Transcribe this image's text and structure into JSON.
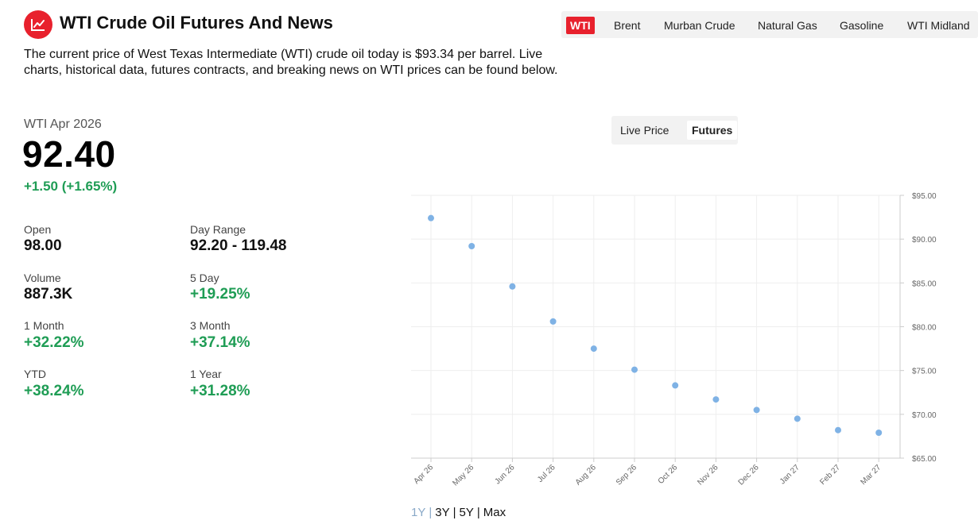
{
  "header": {
    "title": "WTI Crude Oil Futures And News",
    "logo_icon": "chart-line-icon",
    "accent_color": "#e8212d"
  },
  "commodity_tabs": [
    {
      "label": "WTI",
      "active": true
    },
    {
      "label": "Brent",
      "active": false
    },
    {
      "label": "Murban Crude",
      "active": false
    },
    {
      "label": "Natural Gas",
      "active": false
    },
    {
      "label": "Gasoline",
      "active": false
    },
    {
      "label": "WTI Midland",
      "active": false
    }
  ],
  "intro_text": "The current price of West Texas Intermediate (WTI) crude oil today is $93.34 per barrel. Live charts, historical data, futures contracts, and breaking news on WTI prices can be found below.",
  "quote": {
    "contract": "WTI Apr 2026",
    "price": "92.40",
    "change": "+1.50 (+1.65%)",
    "positive_color": "#1f9d55"
  },
  "stats": {
    "open_label": "Open",
    "open_value": "98.00",
    "day_range_label": "Day Range",
    "day_range_value": "92.20 - 119.48",
    "volume_label": "Volume",
    "volume_value": "887.3K",
    "five_day_label": "5 Day",
    "five_day_value": "+19.25%",
    "one_month_label": "1 Month",
    "one_month_value": "+32.22%",
    "three_month_label": "3 Month",
    "three_month_value": "+37.14%",
    "ytd_label": "YTD",
    "ytd_value": "+38.24%",
    "one_year_label": "1 Year",
    "one_year_value": "+31.28%"
  },
  "view_toggle": {
    "live_price": "Live Price",
    "futures": "Futures",
    "active": "Futures"
  },
  "chart_data": {
    "type": "scatter",
    "title": "",
    "xlabel": "",
    "ylabel": "",
    "categories": [
      "Apr 26",
      "May 26",
      "Jun 26",
      "Jul 26",
      "Aug 26",
      "Sep 26",
      "Oct 26",
      "Nov 26",
      "Dec 26",
      "Jan 27",
      "Feb 27",
      "Mar 27"
    ],
    "values": [
      92.4,
      89.2,
      84.6,
      80.6,
      77.5,
      75.1,
      73.3,
      71.7,
      70.5,
      69.5,
      68.2,
      67.9
    ],
    "ylim": [
      65,
      95
    ],
    "yticks": [
      "$95.00",
      "$90.00",
      "$85.00",
      "$80.00",
      "$75.00",
      "$70.00",
      "$65.00"
    ],
    "ytick_values": [
      95,
      90,
      85,
      80,
      75,
      70,
      65
    ],
    "y_axis_position": "right",
    "grid": true,
    "point_color": "#7fb2e5"
  },
  "ranges": [
    {
      "label": "1Y",
      "active": true
    },
    {
      "label": "3Y",
      "active": false
    },
    {
      "label": "5Y",
      "active": false
    },
    {
      "label": "Max",
      "active": false
    }
  ]
}
